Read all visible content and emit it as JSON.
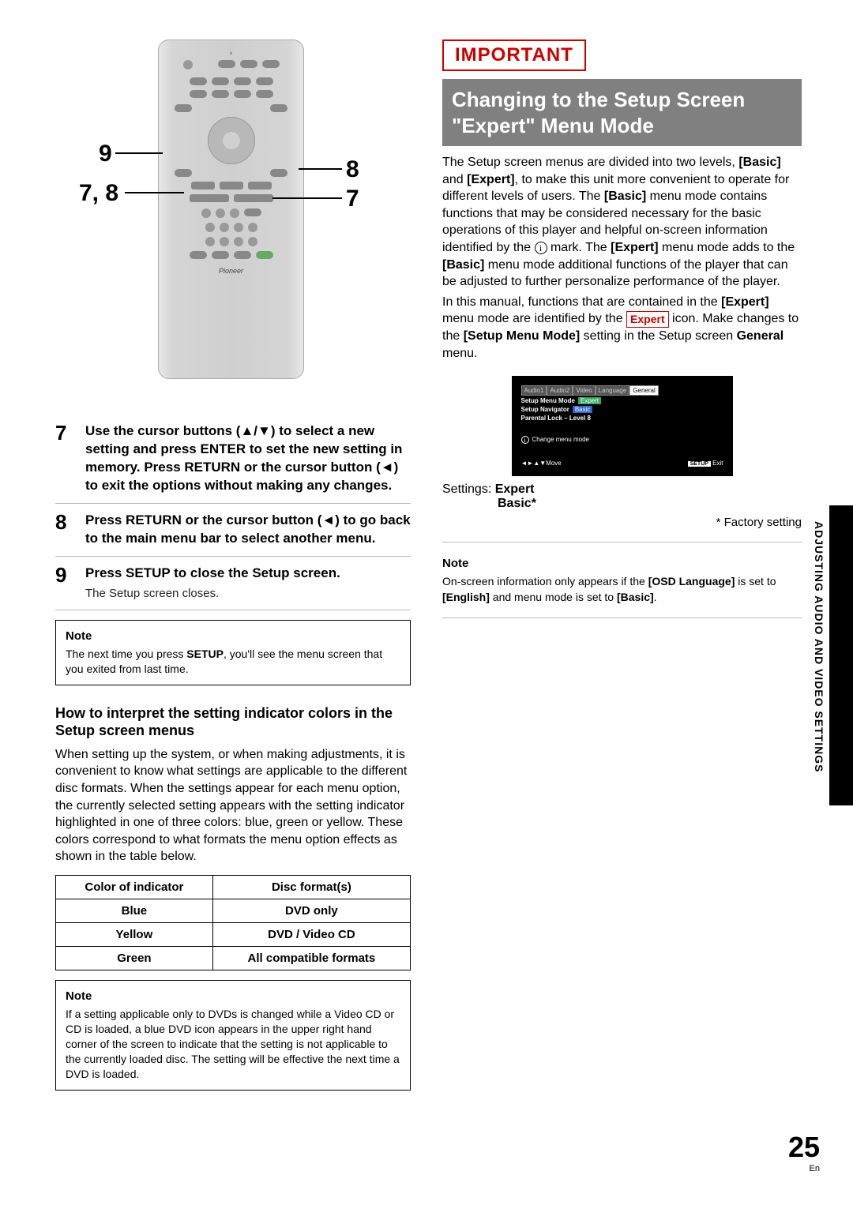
{
  "remote": {
    "callouts": {
      "left_top": "9",
      "left_bottom": "7, 8",
      "right_top": "8",
      "right_bottom": "7"
    },
    "logo": "Pioneer"
  },
  "steps": {
    "s7": {
      "num": "7",
      "text": "Use the cursor buttons (▲/▼) to select a new setting and press ENTER to set the new setting in memory. Press RETURN or the cursor button (◄) to exit the options without making any changes."
    },
    "s8": {
      "num": "8",
      "text": "Press RETURN or the cursor button (◄) to go back to the main menu bar to select another menu."
    },
    "s9": {
      "num": "9",
      "text": "Press SETUP to close the Setup screen.",
      "sub": "The Setup screen closes."
    }
  },
  "note1": {
    "title": "Note",
    "text_a": "The next time you press ",
    "text_b": "SETUP",
    "text_c": ", you'll see the menu screen that you exited from last time."
  },
  "interpret": {
    "heading": "How to interpret the setting indicator colors in the Setup screen menus",
    "para": "When setting up the system, or when making adjustments, it is convenient to know what settings are applicable to the different disc formats. When the settings appear for each menu option, the currently selected setting appears with the setting indicator highlighted in one of three colors: blue, green or yellow. These colors correspond to what formats the menu option effects as shown in the table below."
  },
  "table": {
    "h1": "Color of indicator",
    "h2": "Disc format(s)",
    "rows": [
      {
        "c1": "Blue",
        "c2": "DVD only"
      },
      {
        "c1": "Yellow",
        "c2": "DVD / Video CD"
      },
      {
        "c1": "Green",
        "c2": "All compatible formats"
      }
    ]
  },
  "note2": {
    "title": "Note",
    "text": "If a setting applicable only to DVDs is changed while a Video CD or CD is loaded, a blue DVD icon appears in the upper right hand corner of the screen to indicate that the setting is not applicable to the currently loaded disc. The setting will be effective the next time a DVD is loaded."
  },
  "right": {
    "important": "IMPORTANT",
    "heading": "Changing to the Setup Screen \"Expert\" Menu Mode",
    "para1_a": "The Setup screen menus are divided into two levels, ",
    "para1_b": "[Basic]",
    "para1_c": " and ",
    "para1_d": "[Expert]",
    "para1_e": ", to make this unit more convenient to operate for different levels of users. The ",
    "para1_f": "[Basic]",
    "para1_g": " menu mode contains functions that may be considered necessary for the basic operations of this player and helpful on-screen information identified by the ",
    "para1_h": " mark. The ",
    "para1_i": "[Expert]",
    "para1_j": " menu mode adds to the ",
    "para1_k": "[Basic]",
    "para1_l": " menu mode additional functions of the player that can be adjusted to further personalize performance of the player.",
    "para2_a": "In this manual, functions that are contained in the ",
    "para2_b": "[Expert]",
    "para2_c": " menu mode are identified by the ",
    "para2_d": "Expert",
    "para2_e": " icon. Make changes to the ",
    "para2_f": "[Setup Menu Mode]",
    "para2_g": " setting in the Setup screen ",
    "para2_h": "General",
    "para2_i": " menu.",
    "osd": {
      "tabs": [
        "Audio1",
        "Audio2",
        "Video",
        "Language",
        "General"
      ],
      "row1_label": "Setup Menu Mode",
      "row1_val": "Expert",
      "row2_label": "Setup Navigator",
      "row2_val": "Basic",
      "row3": "Parental Lock – Level 8",
      "hint": "Change menu mode",
      "move": "Move",
      "setup": "SETUP",
      "exit": "Exit"
    },
    "settings_label": "Settings: ",
    "settings_v1": "Expert",
    "settings_v2": "Basic*",
    "factory": "* Factory setting",
    "note3_title": "Note",
    "note3_a": "On-screen information only appears if the ",
    "note3_b": "[OSD Language]",
    "note3_c": " is set to ",
    "note3_d": "[English]",
    "note3_e": " and menu mode is set to ",
    "note3_f": "[Basic]",
    "note3_g": "."
  },
  "side_text": "ADJUSTING AUDIO AND VIDEO SETTINGS",
  "page": {
    "num": "25",
    "lang": "En"
  }
}
